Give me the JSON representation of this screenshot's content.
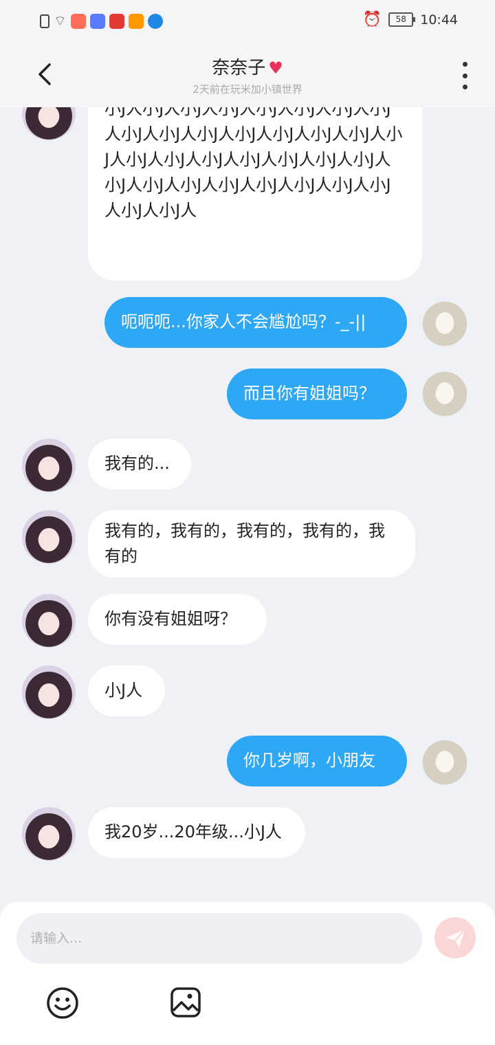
{
  "status_bar": {
    "time": "10:44",
    "battery": "58"
  },
  "header": {
    "title": "奈奈子",
    "subtitle": "2天前在玩米加小镇世界"
  },
  "messages": [
    {
      "side": "in",
      "text": "小J人小J人小J人小J人小J人小J人小J人小J人小J人小J人小J人小J人小J人小J人小J人小J人小J人小J人小J人小J人小J人小J人小J人小J人小J人小J人小J人小J人小J人小J人小J人小J人小J人"
    },
    {
      "side": "out",
      "text": "呃呃呃...你家人不会尴尬吗？-_-||"
    },
    {
      "side": "out",
      "text": "而且你有姐姐吗？"
    },
    {
      "side": "in",
      "text": "我有的..."
    },
    {
      "side": "in",
      "text": "我有的，我有的，我有的，我有的，我有的"
    },
    {
      "side": "in",
      "text": "你有没有姐姐呀？"
    },
    {
      "side": "in",
      "text": "小J人"
    },
    {
      "side": "out",
      "text": "你几岁啊，小朋友"
    },
    {
      "side": "in",
      "text": "我20岁...20年级...小J人"
    }
  ],
  "input": {
    "placeholder": "请输入..."
  },
  "icons": {
    "back": "back-arrow-icon",
    "more": "more-vertical-icon",
    "send": "send-icon",
    "emoji": "emoji-icon",
    "image": "image-icon"
  },
  "colors": {
    "outgoing_bubble": "#2ea8f5",
    "incoming_bubble": "#ffffff",
    "send_button": "#fbd6d6",
    "heart": "#e8315b"
  }
}
